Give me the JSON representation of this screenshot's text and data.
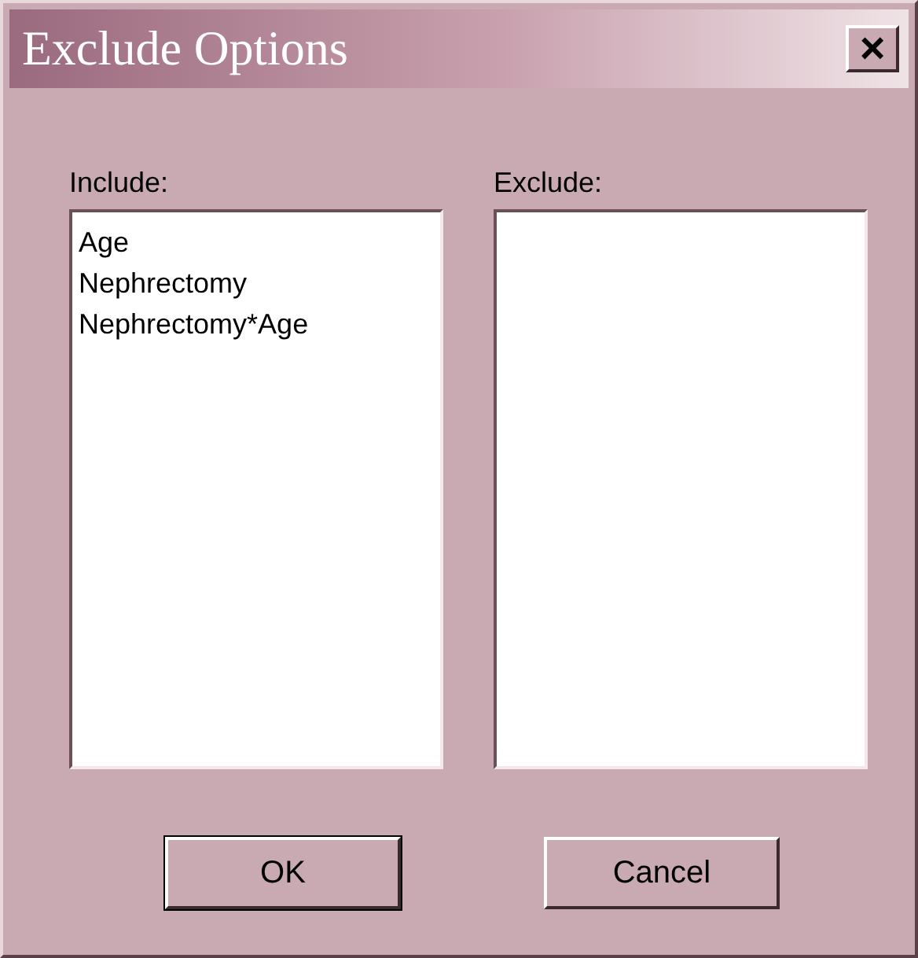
{
  "window": {
    "title": "Exclude Options",
    "close": "×"
  },
  "include": {
    "label": "Include:",
    "items": [
      "Age",
      "Nephrectomy",
      "Nephrectomy*Age"
    ]
  },
  "exclude": {
    "label": "Exclude:"
  },
  "buttons": [
    {
      "label": "OK",
      "default": true
    },
    {
      "label": "Cancel",
      "default": false
    }
  ]
}
